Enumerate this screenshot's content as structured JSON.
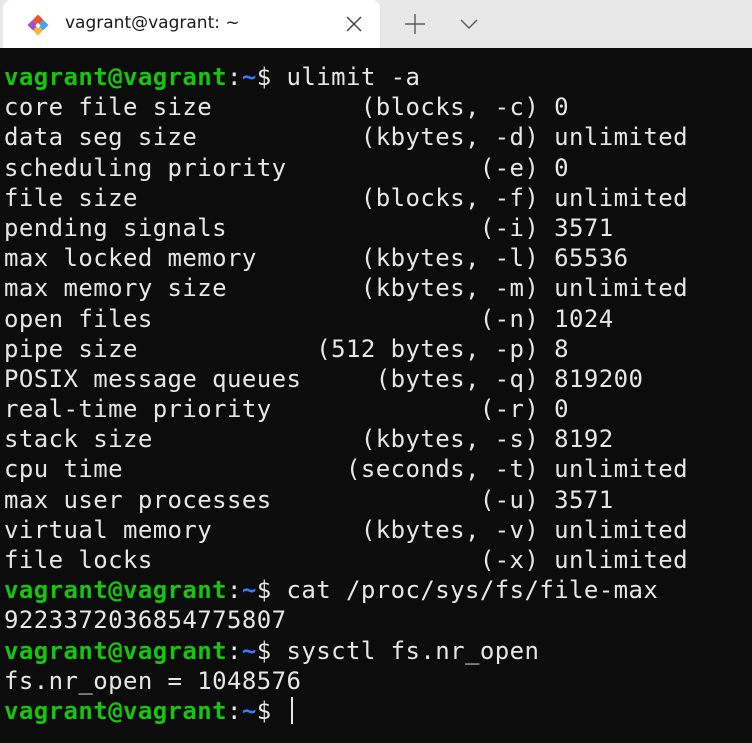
{
  "window": {
    "tab_title": "vagrant@vagrant: ~",
    "tab_icon": "git-bash-icon",
    "close_icon": "close-icon",
    "new_tab_icon": "plus-icon",
    "dropdown_icon": "chevron-down-icon"
  },
  "colors": {
    "background": "#0c0c0c",
    "foreground": "#e6e6e6",
    "prompt_user": "#16c60c",
    "prompt_path": "#3b78ff",
    "tabbar": "#e8e8e8",
    "tab_active": "#ffffff"
  },
  "prompt": {
    "user_host": "vagrant@vagrant",
    "colon": ":",
    "path": "~",
    "symbol": "$ "
  },
  "terminal": {
    "commands": {
      "ulimit": "ulimit -a",
      "cat": "cat /proc/sys/fs/file-max",
      "sysctl": "sysctl fs.nr_open"
    },
    "ulimit_output": [
      "core file size          (blocks, -c) 0",
      "data seg size           (kbytes, -d) unlimited",
      "scheduling priority             (-e) 0",
      "file size               (blocks, -f) unlimited",
      "pending signals                 (-i) 3571",
      "max locked memory       (kbytes, -l) 65536",
      "max memory size         (kbytes, -m) unlimited",
      "open files                      (-n) 1024",
      "pipe size            (512 bytes, -p) 8",
      "POSIX message queues     (bytes, -q) 819200",
      "real-time priority              (-r) 0",
      "stack size              (kbytes, -s) 8192",
      "cpu time               (seconds, -t) unlimited",
      "max user processes              (-u) 3571",
      "virtual memory          (kbytes, -v) unlimited",
      "file locks                      (-x) unlimited"
    ],
    "file_max_output": "9223372036854775807",
    "nr_open_output": "fs.nr_open = 1048576"
  }
}
